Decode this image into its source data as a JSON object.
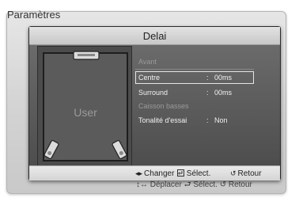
{
  "background_menu": {
    "title": "Paramètres",
    "footer": "↕↔ Déplacer  ⮐ Sélect.  ↺ Retour"
  },
  "dialog": {
    "title": "Delai",
    "preview": {
      "user_label": "User"
    },
    "rows": [
      {
        "label": "Avant",
        "separator": "",
        "value": "",
        "enabled": false
      },
      {
        "label": "Centre",
        "separator": ":",
        "value": "00ms",
        "enabled": true,
        "selected": true
      },
      {
        "label": "Surround",
        "separator": ":",
        "value": "00ms",
        "enabled": true
      },
      {
        "label": "Caisson basses",
        "separator": "",
        "value": "",
        "enabled": false
      },
      {
        "label": "Tonalité d'essai",
        "separator": ":",
        "value": "Non",
        "enabled": true
      }
    ],
    "footer": {
      "change": {
        "icon": "left-right-arrows-icon",
        "label": "Changer"
      },
      "select": {
        "icon": "enter-icon",
        "label": "Sélect."
      },
      "back": {
        "icon": "return-icon",
        "label": "Retour"
      }
    }
  },
  "colors": {
    "disabled_text": "#9a9a9a",
    "enabled_text": "#f2f2f2"
  }
}
